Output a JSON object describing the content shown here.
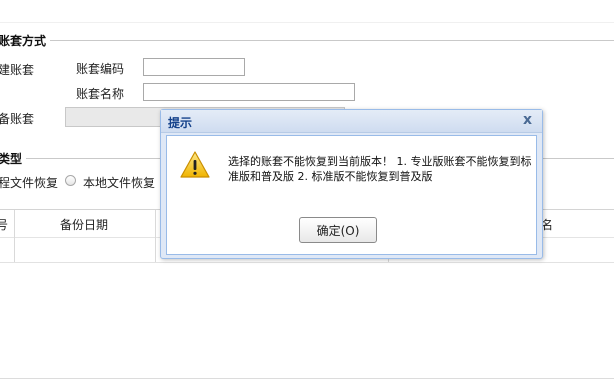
{
  "section_method": {
    "title": "账套方式"
  },
  "form": {
    "new_account_label": "建账套",
    "code_label": "账套编码",
    "code_value": "",
    "name_label": "账套名称",
    "name_value": "",
    "backup_account_label": "备账套"
  },
  "section_type": {
    "title": "类型",
    "remote_label": "程文件恢复",
    "local_label": "本地文件恢复"
  },
  "grid": {
    "columns": [
      "号",
      "备份日期",
      "名"
    ]
  },
  "dialog": {
    "title": "提示",
    "close_glyph": "x",
    "message": "选择的账套不能恢复到当前版本！ 1. 专业版账套不能恢复到标准版和普及版 2. 标准版不能恢复到普及版",
    "ok_label": "确定(O)",
    "icon": "warning-icon"
  },
  "colors": {
    "dialog_border": "#99bbe8",
    "dialog_title": "#15428b",
    "warning_yellow": "#f5c518"
  }
}
